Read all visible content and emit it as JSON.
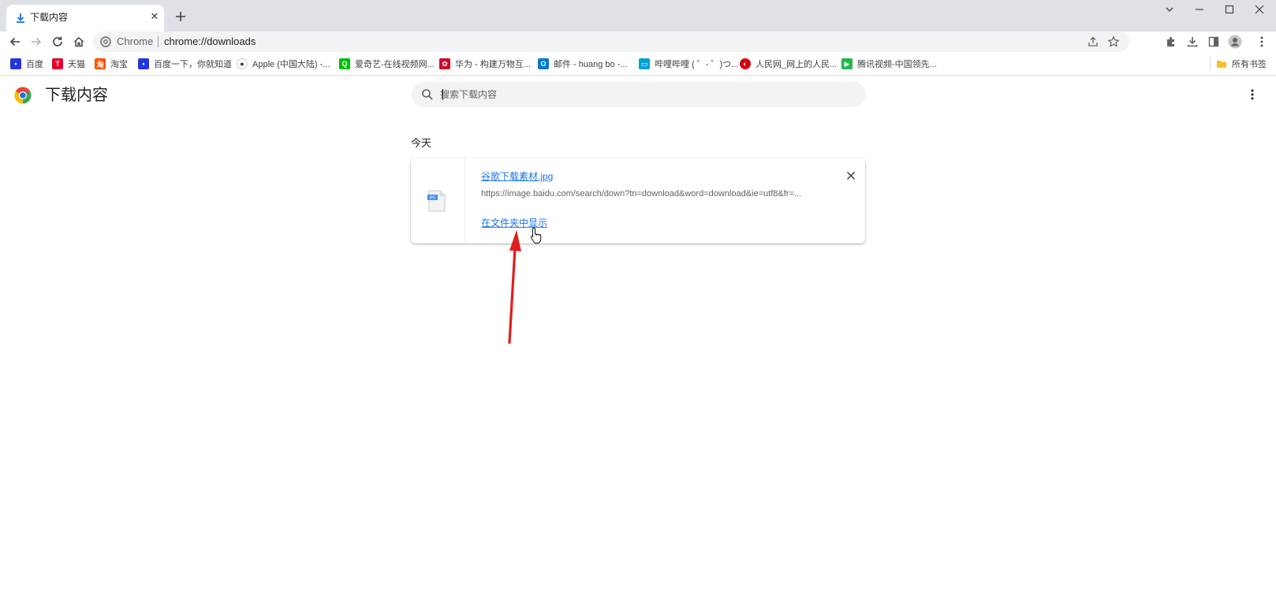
{
  "window": {
    "tab_title": "下载内容",
    "new_tab_icon": "plus-icon"
  },
  "toolbar": {
    "scheme": "Chrome",
    "url": "chrome://downloads"
  },
  "bookmarks": {
    "items": [
      {
        "label": "百度",
        "icon": "baidu-icon",
        "color": "#2932e1"
      },
      {
        "label": "天猫",
        "icon": "tmall-icon",
        "color": "#e4002b"
      },
      {
        "label": "淘宝",
        "icon": "taobao-icon",
        "color": "#ff5000"
      },
      {
        "label": "百度一下，你就知道",
        "icon": "baidu-icon",
        "color": "#2932e1"
      },
      {
        "label": "Apple (中国大陆) -...",
        "icon": "apple-icon",
        "color": "#333333"
      },
      {
        "label": "爱奇艺-在线视频网...",
        "icon": "iqiyi-icon",
        "color": "#00be06"
      },
      {
        "label": "华为 - 构建万物互...",
        "icon": "huawei-icon",
        "color": "#cf0a2c"
      },
      {
        "label": "邮件 - huang bo -...",
        "icon": "outlook-icon",
        "color": "#0078d4"
      },
      {
        "label": "哔哩哔哩 ( ゜- ゜)つ...",
        "icon": "bilibili-icon",
        "color": "#00a1d6"
      },
      {
        "label": "人民网_网上的人民...",
        "icon": "people-icon",
        "color": "#d7000f"
      },
      {
        "label": "腾讯视频-中国领先...",
        "icon": "tencent-video-icon",
        "color": "#20b84a"
      }
    ],
    "all_bookmarks": "所有书签"
  },
  "downloads": {
    "title": "下载内容",
    "search_placeholder": "搜索下载内容",
    "date_group": "今天",
    "item": {
      "file_name": "谷歌下载素材.jpg",
      "file_type": "JPG",
      "url": "https://image.baidu.com/search/down?tn=download&word=download&ie=utf8&fr=...",
      "show_in_folder": "在文件夹中显示"
    }
  },
  "colors": {
    "accent": "#1a73e8",
    "annotation_arrow": "#e01d1d"
  }
}
